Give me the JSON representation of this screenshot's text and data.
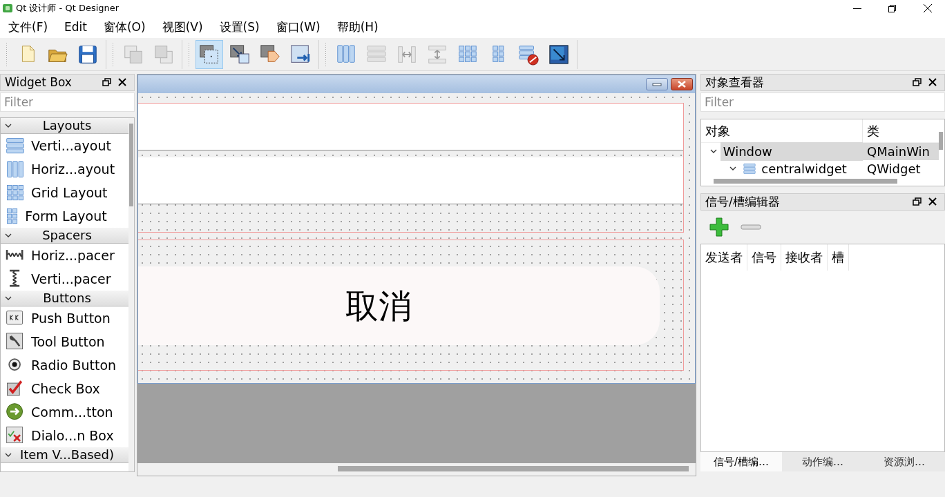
{
  "window": {
    "title": "Qt 设计师 - Qt Designer"
  },
  "menu": [
    "文件(F)",
    "Edit",
    "窗体(O)",
    "视图(V)",
    "设置(S)",
    "窗口(W)",
    "帮助(H)"
  ],
  "toolbar": [
    [
      {
        "kind": "new",
        "disabled": false
      },
      {
        "kind": "open",
        "disabled": false
      },
      {
        "kind": "save",
        "disabled": false
      }
    ],
    [
      {
        "kind": "lower",
        "disabled": true
      },
      {
        "kind": "raise",
        "disabled": true
      }
    ],
    [
      {
        "kind": "edit-widgets",
        "disabled": false,
        "selected": true
      },
      {
        "kind": "edit-signals",
        "disabled": false,
        "selected": false
      },
      {
        "kind": "edit-buddies",
        "disabled": false,
        "selected": false
      },
      {
        "kind": "edit-tab-order",
        "disabled": false,
        "selected": false
      }
    ],
    [
      {
        "kind": "hlayout",
        "disabled": false
      },
      {
        "kind": "vlayout",
        "disabled": true
      },
      {
        "kind": "hsplit",
        "disabled": true
      },
      {
        "kind": "vsplit",
        "disabled": true
      },
      {
        "kind": "grid",
        "disabled": false
      },
      {
        "kind": "form",
        "disabled": false
      },
      {
        "kind": "break",
        "disabled": false
      },
      {
        "kind": "adjust",
        "disabled": false
      }
    ]
  ],
  "widget_box": {
    "title": "Widget Box",
    "filter_placeholder": "Filter",
    "categories": [
      {
        "name": "Layouts",
        "expanded": true,
        "items": [
          {
            "kind": "vlayout",
            "label": "Verti...ayout"
          },
          {
            "kind": "hlayout",
            "label": "Horiz...ayout"
          },
          {
            "kind": "grid",
            "label": "Grid Layout"
          },
          {
            "kind": "form",
            "label": "Form Layout"
          }
        ]
      },
      {
        "name": "Spacers",
        "expanded": true,
        "items": [
          {
            "kind": "hspacer",
            "label": "Horiz...pacer"
          },
          {
            "kind": "vspacer",
            "label": "Verti...pacer"
          }
        ]
      },
      {
        "name": "Buttons",
        "expanded": true,
        "items": [
          {
            "kind": "pushbutton",
            "label": "Push Button"
          },
          {
            "kind": "toolbutton",
            "label": "Tool Button"
          },
          {
            "kind": "radio",
            "label": "Radio Button"
          },
          {
            "kind": "checkbox",
            "label": "Check Box"
          },
          {
            "kind": "command",
            "label": "Comm...tton"
          },
          {
            "kind": "dialogbuttons",
            "label": "Dialo...n Box"
          }
        ]
      },
      {
        "name": "Item V...Based)",
        "expanded": true
      }
    ]
  },
  "form": {
    "button_label": "取消"
  },
  "object_inspector": {
    "title": "对象查看器",
    "filter_placeholder": "Filter",
    "columns": [
      "对象",
      "类"
    ],
    "tree": [
      {
        "name": "Window",
        "class": "QMainWin",
        "expanded": true,
        "selected": true,
        "children": [
          {
            "name": "centralwidget",
            "class": "QWidget",
            "expanded": true,
            "selected": false,
            "kind": "vlayout"
          }
        ]
      }
    ]
  },
  "signal_editor": {
    "title": "信号/槽编辑器",
    "columns": [
      "发送者",
      "信号",
      "接收者",
      "槽"
    ]
  },
  "bottom_tabs": [
    {
      "label": "信号/槽编…",
      "selected": true
    },
    {
      "label": "动作编…",
      "selected": false
    },
    {
      "label": "资源浏…",
      "selected": false
    }
  ]
}
